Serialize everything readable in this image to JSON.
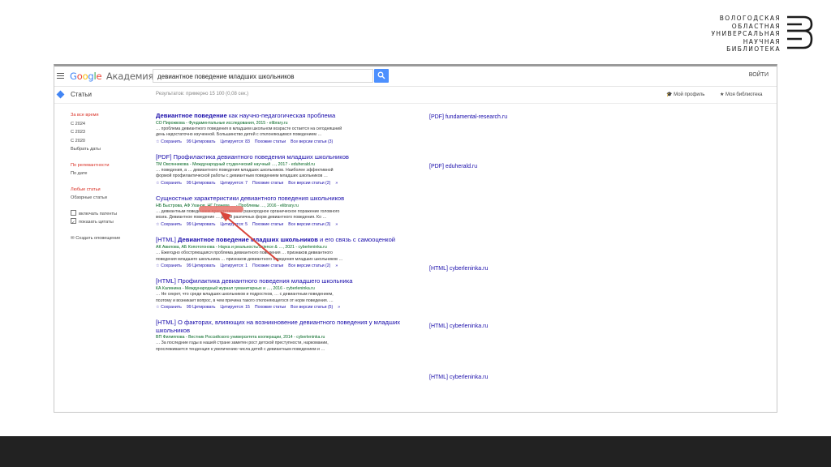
{
  "logo": {
    "lines": [
      "ВОЛОГОДСКАЯ",
      "ОБЛАСТНАЯ",
      "УНИВЕРСАЛЬНАЯ",
      "НАУЧНАЯ",
      "БИБЛИОТЕКА"
    ]
  },
  "header": {
    "brand_google": "Google",
    "brand_product": "Академия",
    "search_value": "девиантное поведение младших школьников",
    "signin": "ВОЙТИ"
  },
  "subbar": {
    "articles": "Статьи",
    "result_count": "Результатов: примерно 15 100 (0,08 сек.)",
    "my_profile": "Мой профиль",
    "my_library": "Моя библиотека"
  },
  "filters": {
    "any_time": "За все время",
    "y1": "С 2024",
    "y2": "С 2023",
    "y3": "С 2020",
    "choose_dates": "Выбрать даты",
    "by_relevance": "По релевантности",
    "by_date": "По дате",
    "any_type": "Любые статьи",
    "reviews": "Обзорные статьи",
    "include_patents": "включать патенты",
    "include_citations": "показать цитаты",
    "create_alert": "Создать оповещение"
  },
  "results": [
    {
      "title_prefix": "",
      "title_bold": "Девиантное поведение",
      "title_rest": " как научно-педагогическая проблема",
      "authors": "СО Пирожкова - Фундаментальные исследования, 2015 - elibrary.ru",
      "snippet1": "… проблема девиантного поведения в младшем школьном возрасте остается на сегодняшний",
      "snippet2": "день недостаточно изученной. Большинство детей с отклоняющимся поведением …",
      "links": [
        "☆ Сохранить",
        "99 Цитировать",
        "Цитируется: 83",
        "Похожие статьи",
        "Все версии статьи (3)"
      ],
      "side": "[PDF] fundamental-research.ru"
    },
    {
      "title_prefix": "[PDF] ",
      "title_bold": "",
      "title_rest": "Профилактика девиантного поведения младших школьников",
      "authors": "ТМ Овсянникова - Международный студенческий научный …, 2017 - eduherald.ru",
      "snippet1": "… поведения, а … девиантного поведения младших школьников. Наиболее эффективной",
      "snippet2": "формой профилактической работы с девиантным поведением младших школьников …",
      "links": [
        "☆ Сохранить",
        "99 Цитировать",
        "Цитируется: 7",
        "Похожие статьи",
        "Все версии статьи (2)",
        "»"
      ],
      "side": "[PDF] eduherald.ru"
    },
    {
      "title_prefix": "",
      "title_bold": "",
      "title_rest": "Сущностные характеристики девиантного поведения школьников",
      "authors": "НБ Быстрова, АФ Уханов, НГ Грачева … - Проблемы …, 2016 - elibrary.ru",
      "snippet1": "… девиантным поведением присутствовало разнородное органическое поражение головного",
      "snippet2": "мозга. Девиантное поведение … детей различных форм девиантного поведения. Ко …",
      "links": [
        "☆ Сохранить",
        "99 Цитировать",
        "Цитируется: 5",
        "Похожие статьи",
        "Все версии статьи (3)",
        "»"
      ],
      "side": ""
    },
    {
      "title_prefix": "[HTML] ",
      "title_bold": "Девиантное поведение младших школьников",
      "title_rest": " и его связь с самооценкой",
      "authors": "АК Авилова, АБ Копотогонова - Наука и реальность/Science & …, 2021 - cyberleninka.ru",
      "snippet1": "… Ежегодно обостряющаяся проблема девиантного поведения … признаков девиантного",
      "snippet2": "поведения младшего школьника … признаков девиантного поведения младших школьников …",
      "links": [
        "☆ Сохранить",
        "99 Цитировать",
        "Цитируется: 1",
        "Похожие статьи",
        "Все версии статьи (2)",
        "»"
      ],
      "side": "[HTML] cyberleninka.ru"
    },
    {
      "title_prefix": "[HTML] ",
      "title_bold": "",
      "title_rest": "Профилактика девиантного поведения младшего школьника",
      "authors": "КА Калинина - Международный журнал гуманитарных и …, 2016 - cyberleninka.ru",
      "snippet1": "… Не секрет, что среди младших школьников и подростков, … с девиантным поведением,",
      "snippet2": "поэтому и возникает вопрос, в чем причина такого отклоняющегося от норм поведения. …",
      "links": [
        "☆ Сохранить",
        "99 Цитировать",
        "Цитируется: 15",
        "Похожие статьи",
        "Все версии статьи (5)",
        "»"
      ],
      "side": "[HTML] cyberleninka.ru"
    },
    {
      "title_prefix": "[HTML] ",
      "title_bold": "",
      "title_rest": "О факторах, влияющих на возникновение девиантного поведения у младших школьников",
      "authors": "ВП Филиппова - Вестник Российского университета кооперации, 2014 - cyberleninka.ru",
      "snippet1": "… За последние годы в нашей стране заметен рост детской преступности, наркомании,",
      "snippet2": "прослеживается тенденция к увеличению числа детей с девиантным поведением и …",
      "links": [],
      "side": "[HTML] cyberleninka.ru"
    }
  ]
}
